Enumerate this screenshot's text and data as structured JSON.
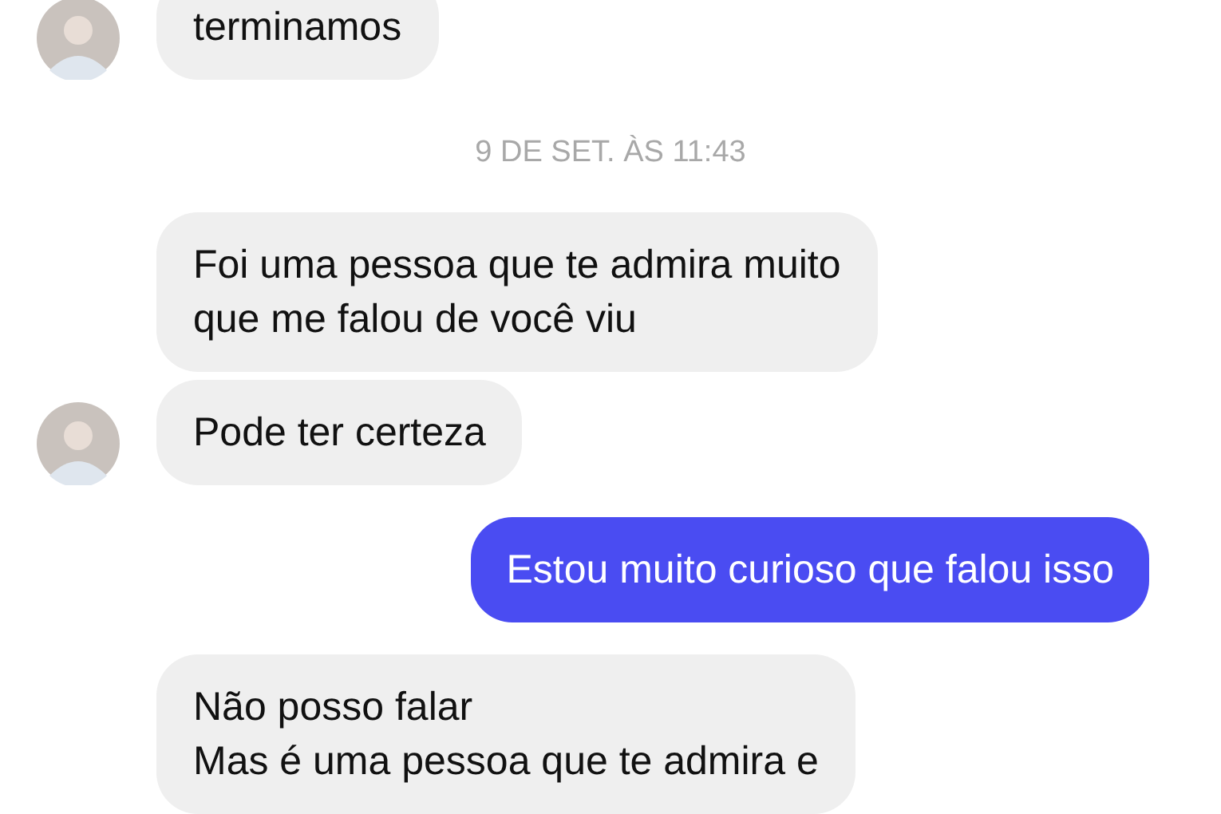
{
  "messages": [
    {
      "kind": "received",
      "text": "terminamos",
      "avatar": true
    },
    {
      "kind": "timestamp",
      "text": "9 DE SET. ÀS 11:43"
    },
    {
      "kind": "received",
      "text": "Foi uma pessoa que te admira muito\nque me falou de você viu",
      "avatar": false
    },
    {
      "kind": "received",
      "text": "Pode ter certeza",
      "avatar": true
    },
    {
      "kind": "sent",
      "text": "Estou muito curioso que falou isso"
    },
    {
      "kind": "received",
      "text": "Não posso falar\nMas é uma pessoa que te admira e",
      "avatar": false
    }
  ]
}
